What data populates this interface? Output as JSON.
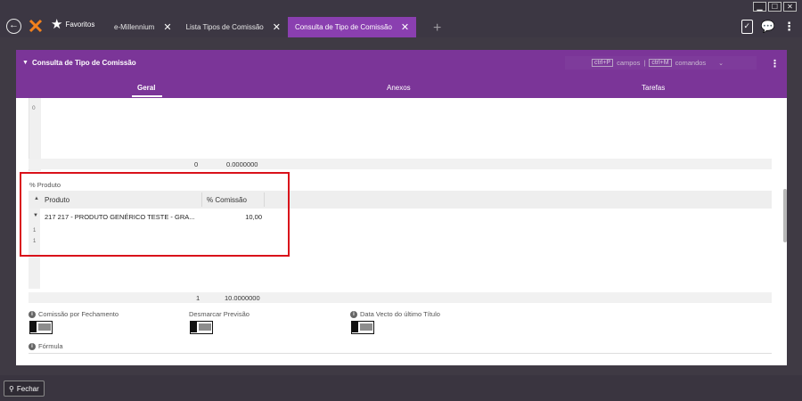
{
  "window_controls": [
    "▁",
    "☐",
    "✕"
  ],
  "nav": {
    "favoritos_label": "Favoritos"
  },
  "tabs": [
    {
      "label": "e-Millennium"
    },
    {
      "label": "Lista Tipos de Comissão"
    },
    {
      "label": "Consulta de Tipo de Comissão"
    }
  ],
  "panel": {
    "title": "Consulta de Tipo de Comissão",
    "shortcut_campos_key": "ctrl+P",
    "shortcut_campos_label": "campos",
    "shortcut_separator": "|",
    "shortcut_comandos_key": "ctrl+M",
    "shortcut_comandos_label": "comandos",
    "tabs": [
      "Geral",
      "Anexos",
      "Tarefas"
    ]
  },
  "grid1": {
    "row_number": "0",
    "footer_count": "0",
    "footer_total": "0.0000000"
  },
  "produto_section": {
    "label": "% Produto",
    "columns": [
      "Produto",
      "% Comissão"
    ],
    "rows": [
      {
        "produto": "217 217 - PRODUTO GENÉRICO TESTE - GRA...",
        "comissao": "10,00"
      }
    ],
    "row_numbers": [
      "1",
      "1"
    ],
    "footer_count": "1",
    "footer_total": "10.0000000"
  },
  "fields": {
    "comissao_fechamento": "Comissão por Fechamento",
    "desmarcar_previsao": "Desmarcar Previsão",
    "data_vecto": "Data Vecto do último Título",
    "formula": "Fórmula"
  },
  "footer": {
    "fechar_label": "Fechar"
  },
  "colors": {
    "accent": "#7b3598",
    "active_tab": "#8a3fb0",
    "highlight": "#d9111a"
  }
}
